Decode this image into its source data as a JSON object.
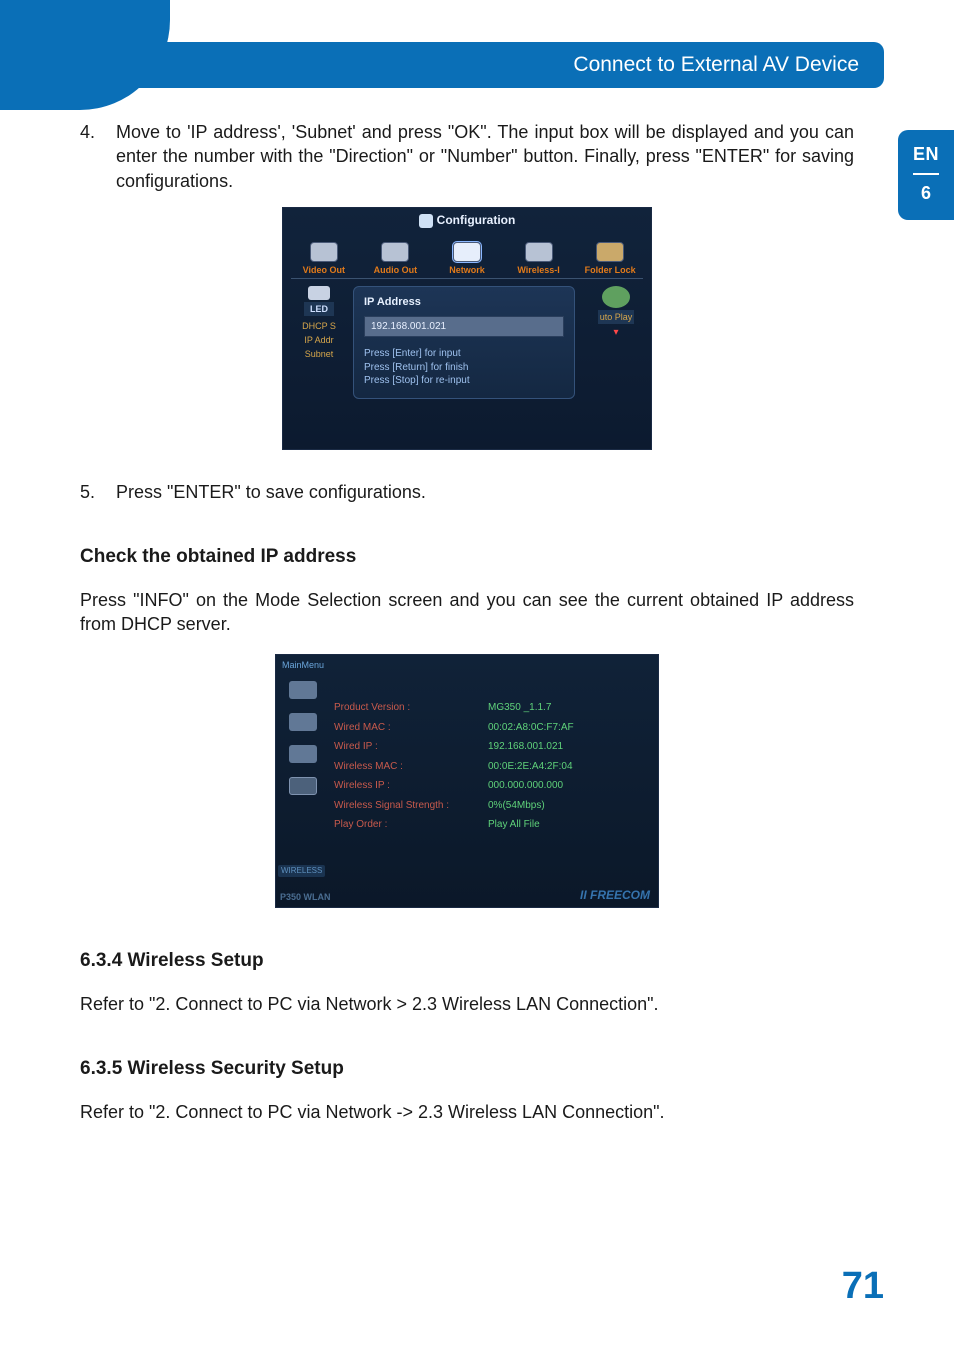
{
  "header": {
    "title": "Connect to External AV Device"
  },
  "side_tab": {
    "lang": "EN",
    "chapter": "6"
  },
  "steps": {
    "s4": {
      "num": "4.",
      "text": "Move to 'IP address', 'Subnet' and press \"OK\". The input box will be displayed and you can enter the number with the \"Direction\" or \"Number\" button. Finally, press \"ENTER\" for saving configurations."
    },
    "s5": {
      "num": "5.",
      "text": "Press \"ENTER\" to save configurations."
    }
  },
  "subsections": {
    "check_ip": {
      "heading": "Check the obtained IP address",
      "body": "Press \"INFO\" on the Mode Selection screen and you can see the current obtained IP address from DHCP server."
    },
    "s634": {
      "heading": "6.3.4 Wireless Setup",
      "body": "Refer to \"2. Connect to PC via Network > 2.3 Wireless LAN Connection\"."
    },
    "s635": {
      "heading": "6.3.5 Wireless Security Setup",
      "body": "Refer to \"2. Connect to PC via Network -> 2.3 Wireless LAN Connection\"."
    }
  },
  "shot1": {
    "title": "Configuration",
    "tabs": [
      "Video Out",
      "Audio Out",
      "Network",
      "Wireless-I",
      "Folder Lock"
    ],
    "left": {
      "led": "LED",
      "items": [
        "DHCP S",
        "IP Addr",
        "Subnet"
      ]
    },
    "mid": {
      "label": "IP Address",
      "value": "192.168.001.021",
      "help": [
        "Press [Enter] for input",
        "Press [Return] for finish",
        "Press [Stop] for re-input"
      ]
    },
    "right": {
      "label": "uto Play",
      "down": "▾"
    }
  },
  "shot2": {
    "mainmenu": "MainMenu",
    "wireless_label": "WIRELESS",
    "rows": [
      {
        "k": "Product Version :",
        "v": "MG350 _1.1.7"
      },
      {
        "k": "Wired MAC :",
        "v": "00:02:A8:0C:F7:AF"
      },
      {
        "k": "Wired IP :",
        "v": "192.168.001.021"
      },
      {
        "k": "Wireless MAC :",
        "v": "00:0E:2E:A4:2F:04"
      },
      {
        "k": "Wireless IP :",
        "v": "000.000.000.000"
      },
      {
        "k": "Wireless Signal Strength :",
        "v": "0%(54Mbps)"
      },
      {
        "k": "Play Order :",
        "v": "Play All File"
      }
    ],
    "brand": "P350 WLAN",
    "logo": "II FREECOM"
  },
  "page_number": "71"
}
